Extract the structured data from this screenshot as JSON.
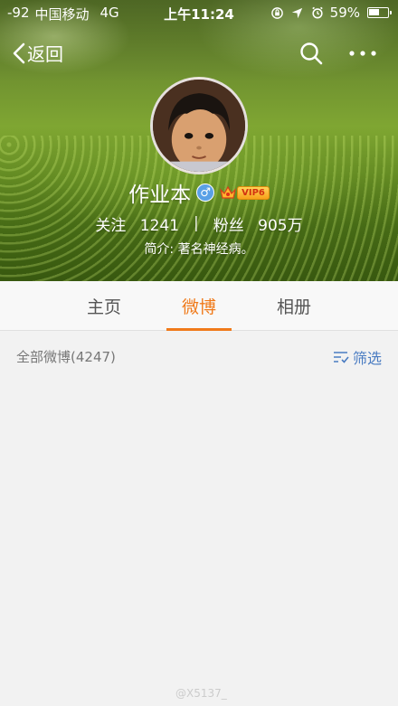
{
  "status_bar": {
    "signal": "-92",
    "carrier": "中国移动",
    "network": "4G",
    "time": "上午11:24",
    "battery_percent": "59%",
    "battery_level": 0.59
  },
  "navbar": {
    "back_label": "返回"
  },
  "profile": {
    "name": "作业本",
    "vip_label": "VIP6",
    "following_label": "关注",
    "following_count": "1241",
    "separator": "|",
    "followers_label": "粉丝",
    "followers_count": "905万",
    "bio": "简介: 著名神经病。"
  },
  "tabs": [
    {
      "label": "主页",
      "active": false
    },
    {
      "label": "微博",
      "active": true
    },
    {
      "label": "相册",
      "active": false
    }
  ],
  "filter": {
    "title": "全部微博(4247)",
    "button_label": "筛选"
  },
  "watermark": "@X5137_",
  "colors": {
    "accent": "#f07a1a",
    "link": "#4a7cc2",
    "gender": "#5aa0e6"
  }
}
